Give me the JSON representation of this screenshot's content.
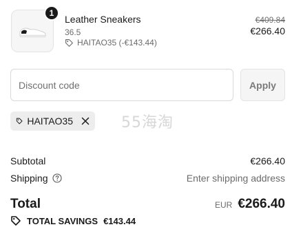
{
  "product": {
    "quantity": "1",
    "name": "Leather Sneakers",
    "variant": "36.5",
    "discount_line": "HAITAO35 (-€143.44)",
    "original_price": "€409.84",
    "price": "€266.40"
  },
  "discount": {
    "placeholder": "Discount code",
    "apply_label": "Apply",
    "applied_code": "HAITAO35"
  },
  "watermark": "55海淘",
  "summary": {
    "subtotal_label": "Subtotal",
    "subtotal_value": "€266.40",
    "shipping_label": "Shipping",
    "shipping_value": "Enter shipping address",
    "total_label": "Total",
    "total_currency": "EUR",
    "total_value": "€266.40",
    "savings_label": "TOTAL SAVINGS",
    "savings_value": "€143.44"
  }
}
